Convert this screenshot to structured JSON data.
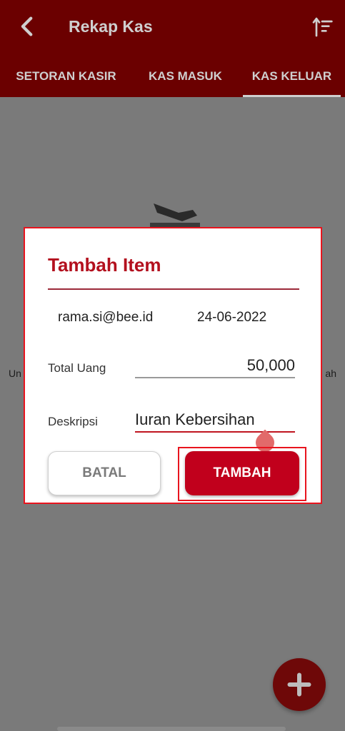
{
  "header": {
    "title": "Rekap Kas",
    "back_icon": "back-arrow-icon",
    "sort_icon": "sort-icon"
  },
  "tabs": [
    {
      "label": "SETORAN KASIR",
      "active": false
    },
    {
      "label": "KAS MASUK",
      "active": false
    },
    {
      "label": "KAS KELUAR",
      "active": true
    }
  ],
  "background": {
    "text_left": "Un",
    "text_right": "ah"
  },
  "dialog": {
    "title": "Tambah Item",
    "user_email": "rama.si@bee.id",
    "date": "24-06-2022",
    "total_label": "Total Uang",
    "total_value": "50,000",
    "desc_label": "Deskripsi",
    "desc_value": "Iuran Kebersihan",
    "cancel_label": "BATAL",
    "add_label": "TAMBAH"
  },
  "fab": {
    "icon": "plus-icon"
  },
  "colors": {
    "appbar": "#6b0000",
    "accent": "#c1001c",
    "title_red": "#b3101e",
    "highlight": "#e8141e"
  }
}
